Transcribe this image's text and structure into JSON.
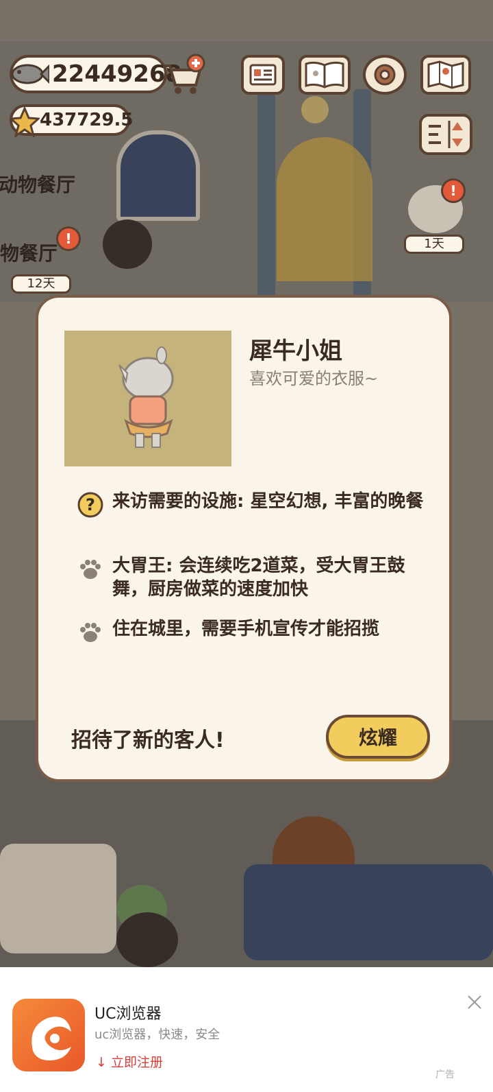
{
  "hud": {
    "coins": "22449268",
    "stars": "437729.5"
  },
  "scene": {
    "left_label_1": "动物餐厅",
    "left_label_2": "物餐厅",
    "left_day": "12天",
    "right_day": "1天",
    "alert_mark": "!"
  },
  "guest": {
    "name": "犀牛小姐",
    "subtitle": "喜欢可爱的衣服~",
    "traits": [
      {
        "icon": "question-icon",
        "text": "来访需要的设施: 星空幻想, 丰富的晚餐"
      },
      {
        "icon": "paw-icon",
        "text": "大胃王: 会连续吃2道菜，受大胃王鼓舞，厨房做菜的速度加快"
      },
      {
        "icon": "paw-icon",
        "text": "住在城里，需要手机宣传才能招揽"
      }
    ],
    "footer": "招待了新的客人!",
    "show_button": "炫耀"
  },
  "ad": {
    "title": "UC浏览器",
    "description": "uc浏览器，快速，安全",
    "cta": "立即注册",
    "tag": "广告"
  },
  "colors": {
    "modal_bg": "#fbf4ea",
    "button_yellow": "#f2cd5d",
    "portrait_bg": "#c4b37a",
    "ad_cta_red": "#d8403a"
  }
}
